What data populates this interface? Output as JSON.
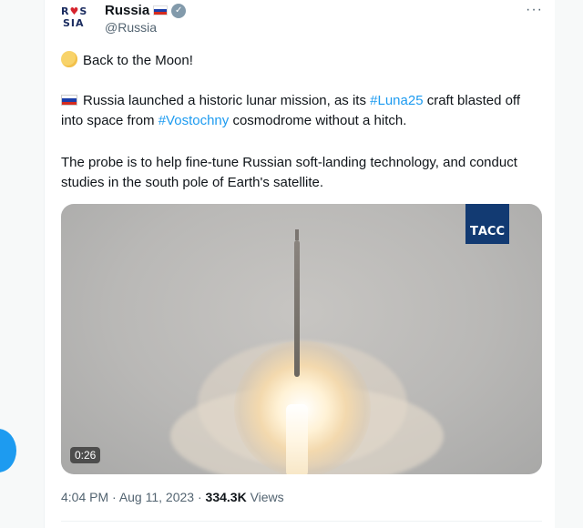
{
  "tweet": {
    "author": {
      "name": "Russia",
      "handle": "@Russia",
      "avatar_text": [
        "R♥S",
        "SIA"
      ],
      "flag_colors": [
        "#ffffff",
        "#1c3faa",
        "#d52b1e"
      ],
      "verified_color": "#829aab"
    },
    "more_label": "···",
    "paragraph1": "Back to the Moon!",
    "paragraph2": {
      "part1": "Russia launched a historic lunar mission, as its ",
      "hashtag1": "#Luna25",
      "part2": " craft blasted off into space from ",
      "hashtag2": "#Vostochny",
      "part3": " cosmodrome without a hitch."
    },
    "paragraph3": "The probe is to help fine-tune Russian soft-landing technology, and conduct studies in the south pole of Earth's satellite.",
    "media": {
      "watermark": "ТАСС",
      "duration": "0:26"
    },
    "meta": {
      "time": "4:04 PM",
      "separator": " · ",
      "date": "Aug 11, 2023",
      "views_count": "334.3K",
      "views_label": " Views"
    }
  },
  "colors": {
    "accent": "#1d9bf0",
    "text": "#0f1419",
    "secondary_text": "#536471"
  }
}
